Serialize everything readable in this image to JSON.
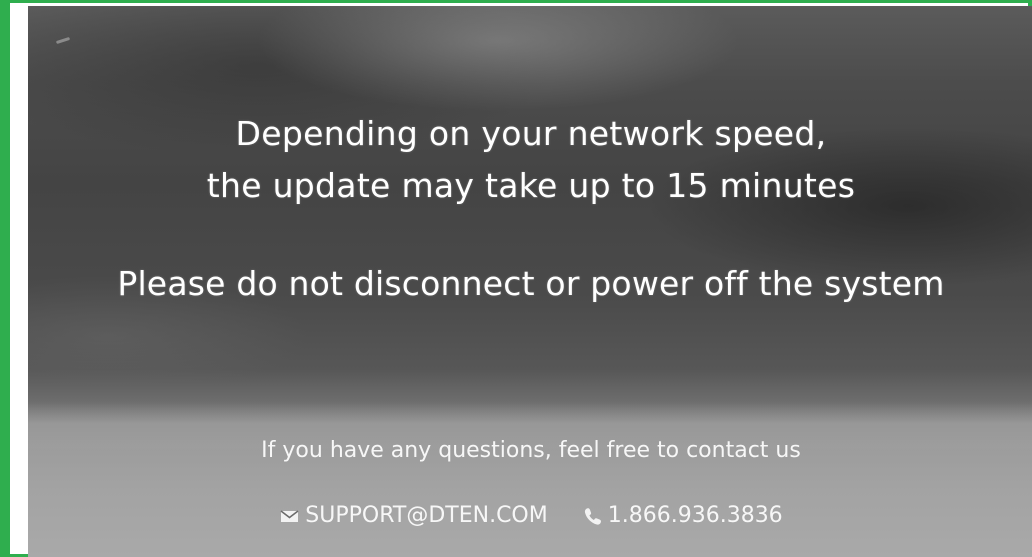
{
  "message": {
    "line1": "Depending on your network speed,",
    "line2": "the update may take up to 15 minutes",
    "warning": "Please do not disconnect or power off the system"
  },
  "contact": {
    "prompt": "If you have any questions, feel free to contact us",
    "email": "SUPPORT@DTEN.COM",
    "email_icon": "envelope-icon",
    "phone": "1.866.936.3836",
    "phone_icon": "phone-icon"
  },
  "colors": {
    "frame_border": "#2fae4e",
    "text": "#ffffff"
  }
}
